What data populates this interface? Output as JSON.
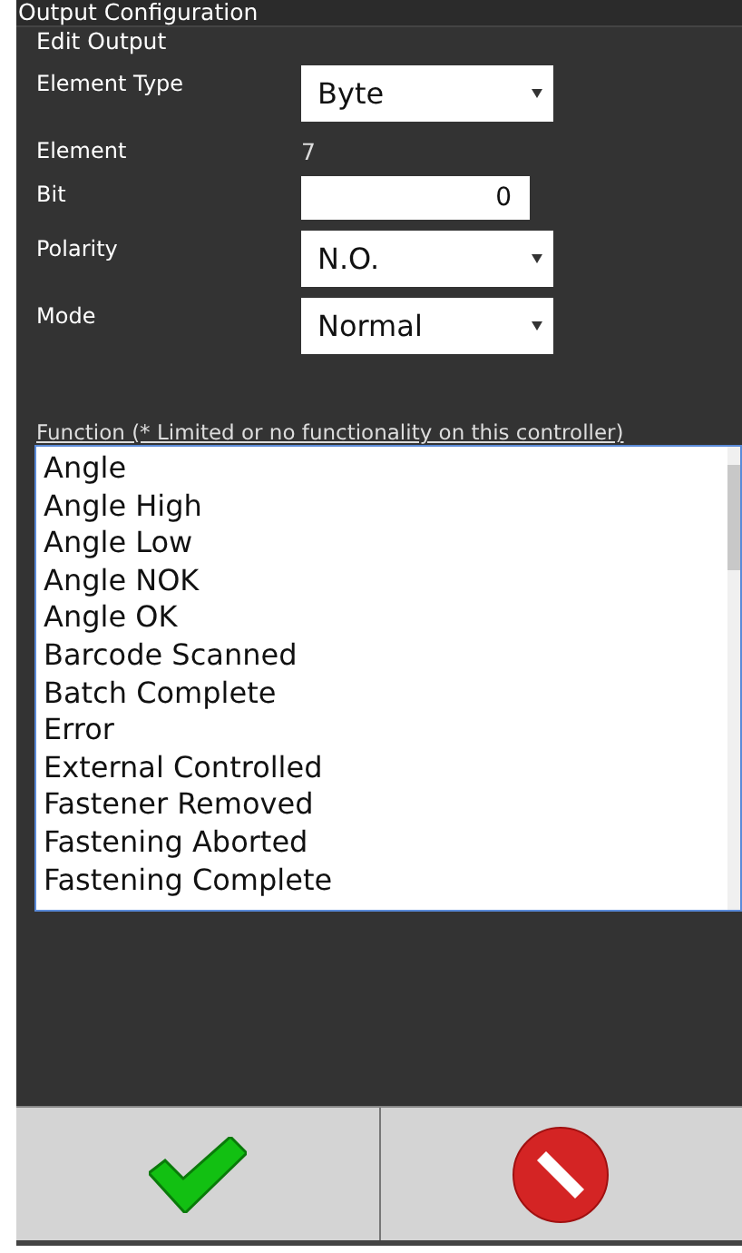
{
  "window": {
    "title": "Output Configuration"
  },
  "group": {
    "legend": "Edit Output"
  },
  "fields": [
    {
      "kind": "select",
      "label": "Element Type",
      "value": "Byte"
    },
    {
      "kind": "text",
      "label": "Element",
      "value": "7"
    },
    {
      "kind": "input",
      "label": "Bit",
      "value": "0"
    },
    {
      "kind": "select",
      "label": "Polarity",
      "value": "N.O."
    },
    {
      "kind": "select",
      "label": "Mode",
      "value": "Normal"
    }
  ],
  "function_list": {
    "label": "Function (* Limited or no functionality on this controller)",
    "items": [
      {
        "label": "Angle",
        "selected": false
      },
      {
        "label": "Angle High",
        "selected": false
      },
      {
        "label": "Angle Low",
        "selected": false
      },
      {
        "label": "Angle NOK",
        "selected": false
      },
      {
        "label": "Angle OK",
        "selected": false
      },
      {
        "label": "Barcode Scanned",
        "selected": false
      },
      {
        "label": "Batch Complete",
        "selected": false
      },
      {
        "label": "Error",
        "selected": false
      },
      {
        "label": "External Controlled",
        "selected": false
      },
      {
        "label": "Fastener Removed",
        "selected": false
      },
      {
        "label": "Fastening Aborted",
        "selected": false
      },
      {
        "label": "Fastening Complete",
        "selected": false
      }
    ]
  },
  "buttons": [
    {
      "kind": "ok"
    },
    {
      "kind": "cancel"
    }
  ]
}
